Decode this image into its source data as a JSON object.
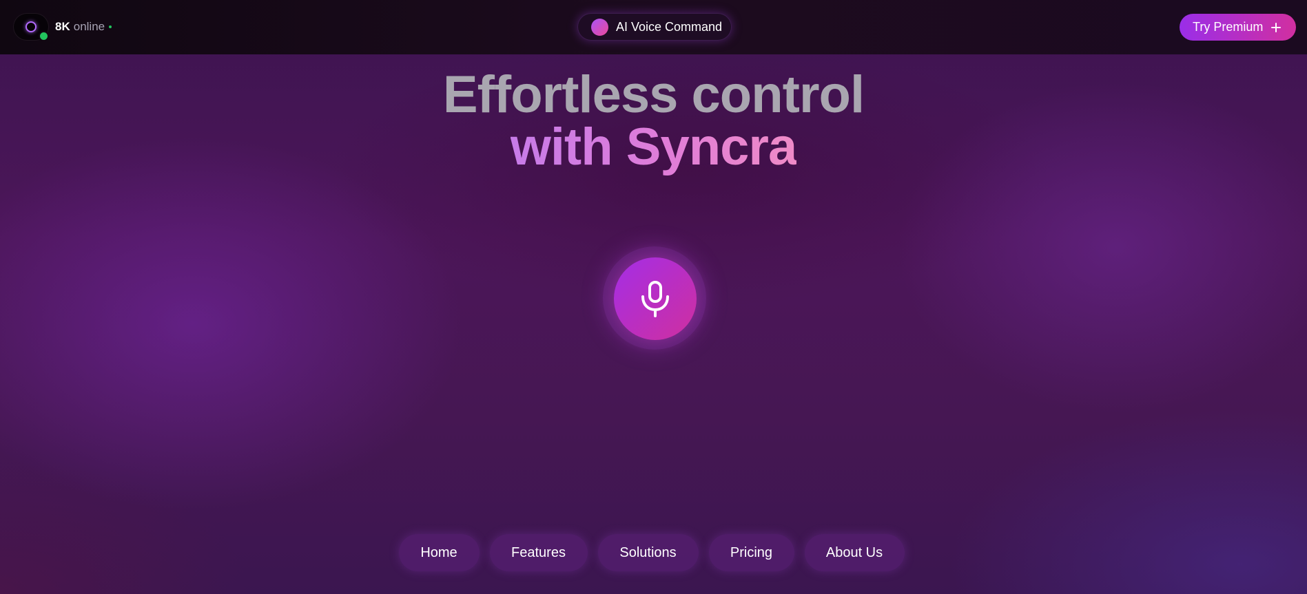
{
  "header": {
    "online_count": "8K",
    "online_label": "online",
    "voice_command_label": "AI Voice Command",
    "premium_label": "Try Premium"
  },
  "hero": {
    "title_line1": "Effortless control",
    "title_line2": "with Syncra"
  },
  "nav": {
    "items": [
      {
        "label": "Home"
      },
      {
        "label": "Features"
      },
      {
        "label": "Solutions"
      },
      {
        "label": "Pricing"
      },
      {
        "label": "About Us"
      }
    ]
  },
  "icons": {
    "logo": "logo-ring-icon",
    "status": "online-status-dot",
    "voice": "voice-orb-icon",
    "premium": "plus-icon",
    "mic": "microphone-icon"
  },
  "colors": {
    "accent_purple": "#a42ee6",
    "accent_pink": "#cf2f9f",
    "online_green": "#22c55e"
  }
}
